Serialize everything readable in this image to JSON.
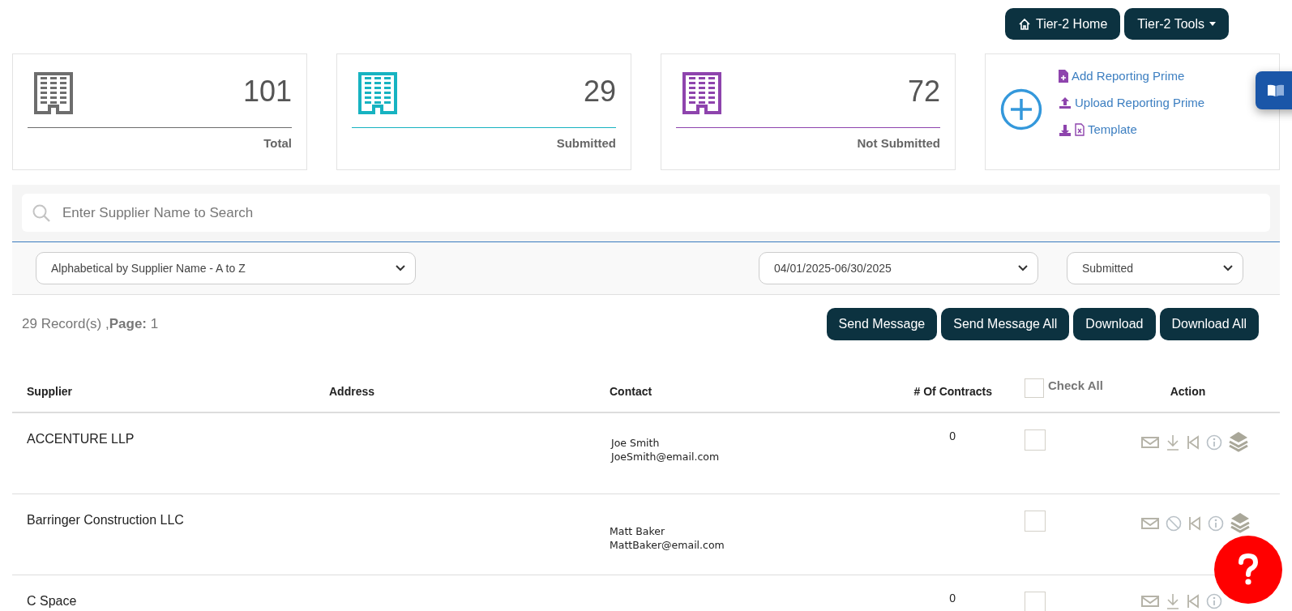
{
  "top_nav": [
    {
      "label": "Tier-2 Home",
      "kind": "home"
    },
    {
      "label": "Tier-2 Tools",
      "kind": "dropdown"
    }
  ],
  "stats": [
    {
      "value": "101",
      "label": "Total",
      "color": "#6d6d6d"
    },
    {
      "value": "29",
      "label": "Submitted",
      "color": "#17b3c1"
    },
    {
      "value": "72",
      "label": "Not Submitted",
      "color": "#8e44ad"
    }
  ],
  "actions_panel": {
    "links": [
      {
        "label": "Add Reporting Prime",
        "kind": "add"
      },
      {
        "label": "Upload Reporting Prime",
        "kind": "upload"
      },
      {
        "label": "Template",
        "kind": "template"
      }
    ]
  },
  "search": {
    "placeholder": "Enter Supplier Name to Search"
  },
  "filters": {
    "sort": "Alphabetical by Supplier Name - A to Z",
    "date_range": "04/01/2025-06/30/2025",
    "status": "Submitted"
  },
  "records": "29 Record(s) ,**Page:** 1",
  "buttons": [
    "Send Message",
    "Send Message All",
    "Download",
    "Download All"
  ],
  "table": {
    "columns": [
      "Supplier",
      "Address",
      "Contact",
      "# Of Contracts",
      "Check All",
      "Action"
    ],
    "check_all": false,
    "rows": [
      {
        "supplier": "ACCENTURE LLP",
        "contact_name": "Joe Smith",
        "contact_email": "JoeSmith@email.com",
        "contracts": "0",
        "checked": false,
        "actions": [
          {
            "kind": "mail"
          },
          {
            "kind": "download"
          },
          {
            "kind": "back"
          },
          {
            "kind": "info"
          },
          {
            "kind": "layers"
          }
        ]
      },
      {
        "supplier": "Barringer Construction LLC",
        "contact_name": "Matt Baker",
        "contact_email": "MattBaker@email.com",
        "checked": false,
        "actions": [
          {
            "kind": "mail"
          },
          {
            "kind": "ban"
          },
          {
            "kind": "back"
          },
          {
            "kind": "info"
          },
          {
            "kind": "layers"
          }
        ]
      },
      {
        "supplier": "C Space",
        "contracts": "0",
        "checked": false,
        "actions": [
          {
            "kind": "mail"
          },
          {
            "kind": "download"
          },
          {
            "kind": "back"
          },
          {
            "kind": "info"
          }
        ]
      }
    ]
  }
}
